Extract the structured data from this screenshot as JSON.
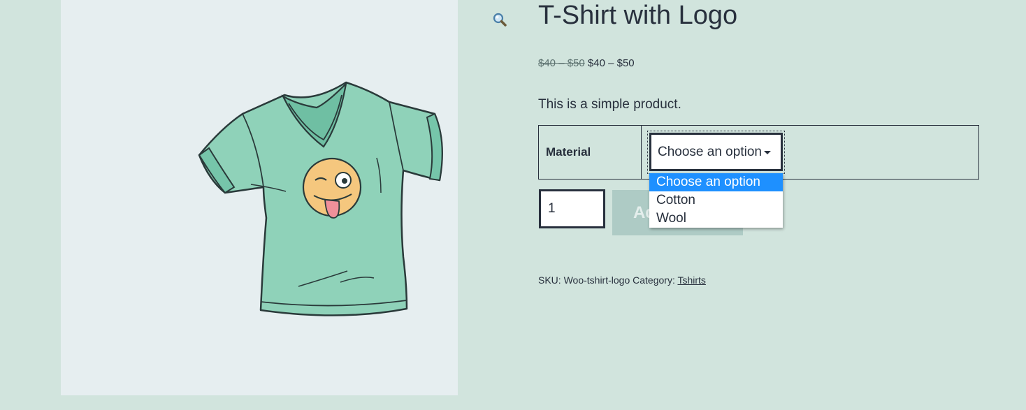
{
  "gallery": {
    "zoom_icon": "magnifier-zoom-icon",
    "image": "t-shirt-with-winking-emoji-logo"
  },
  "product": {
    "title": "T-Shirt with Logo",
    "price_regular": "$40 – $50",
    "price_sale": "$40 – $50",
    "description": "This is a simple product."
  },
  "variations": {
    "label": "Material",
    "select": {
      "current": "Choose an option",
      "options": [
        "Choose an option",
        "Cotton",
        "Wool"
      ],
      "highlighted_index": 0
    }
  },
  "cart": {
    "quantity": "1",
    "add_button_label": "Add to cart"
  },
  "meta": {
    "sku_label": "SKU:",
    "sku_value": "Woo-tshirt-logo",
    "category_label": "Category:",
    "category_link": "Tshirts"
  },
  "colors": {
    "page_background": "#d1e4dd",
    "gallery_background": "#e6eef0",
    "text": "#28303d",
    "button_disabled": "#aecbc5",
    "option_highlight": "#1e90ff"
  }
}
